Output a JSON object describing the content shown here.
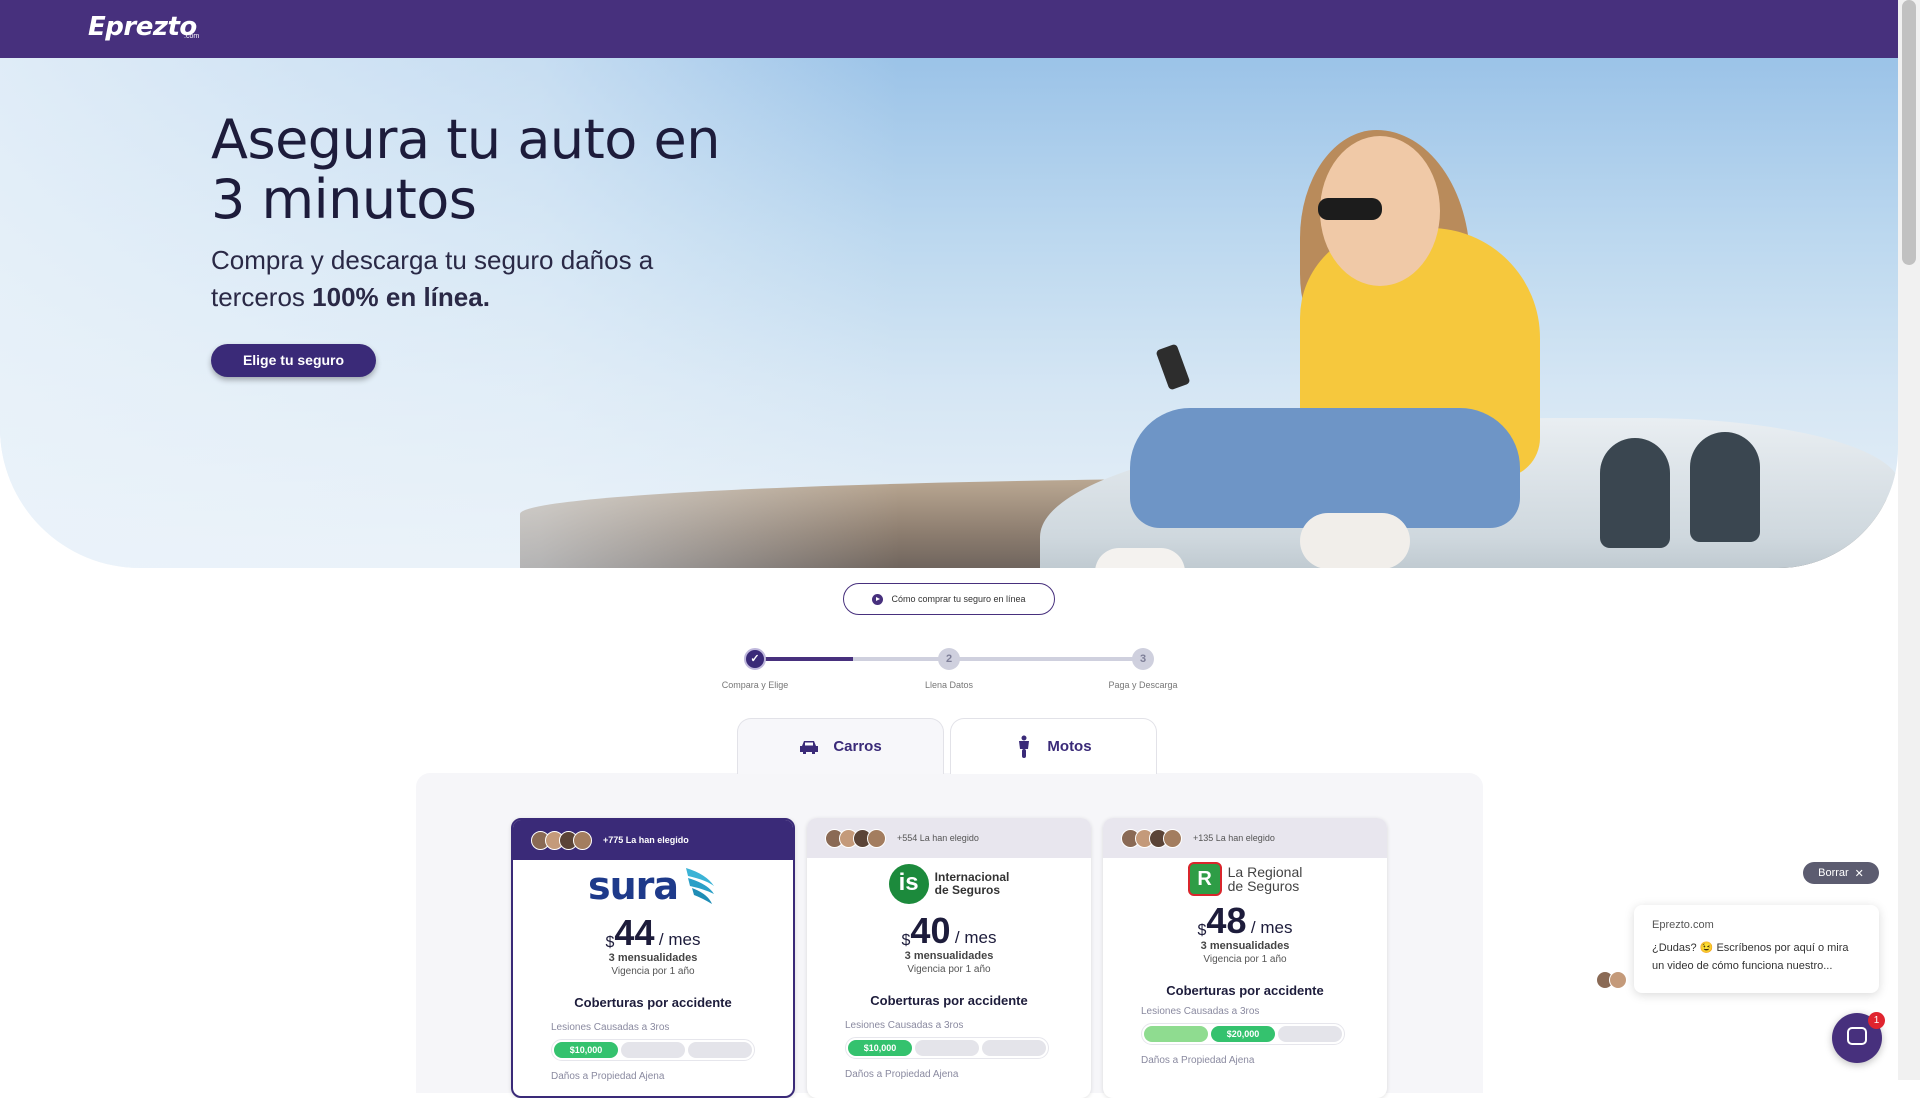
{
  "header": {
    "logo": "Eprezto",
    "logo_suffix": ".com"
  },
  "hero": {
    "title": "Asegura tu auto en 3 minutos",
    "subtitle_prefix": "Compra y descarga tu seguro daños a terceros ",
    "subtitle_bold": "100% en línea.",
    "cta": "Elige tu seguro"
  },
  "howto": {
    "label": "Cómo comprar tu seguro en línea",
    "icon": "play-icon"
  },
  "stepper": {
    "steps": [
      {
        "number": "✓",
        "label": "Compara y Elige",
        "state": "done"
      },
      {
        "number": "2",
        "label": "Llena Datos",
        "state": "todo"
      },
      {
        "number": "3",
        "label": "Paga y Descarga",
        "state": "todo"
      }
    ],
    "progress": 0.25
  },
  "tabs": [
    {
      "label": "Carros",
      "icon": "car-icon",
      "active": true
    },
    {
      "label": "Motos",
      "icon": "scooter-icon",
      "active": false
    }
  ],
  "cards": [
    {
      "chosen": "+775 La han elegido",
      "brand": "sura",
      "currency": "$",
      "price": "44",
      "per": "/ mes",
      "installments": "3 mensualidades",
      "validity": "Vigencia por 1 año",
      "coverage_title": "Coberturas por accidente",
      "cov1_label": "Lesiones Causadas a 3ros",
      "cov1_value": "$10,000",
      "cov2_label": "Daños a Propiedad Ajena"
    },
    {
      "chosen": "+554 La han elegido",
      "brand_line1": "Internacional",
      "brand_line2": "de Seguros",
      "brand_mark": "is",
      "currency": "$",
      "price": "40",
      "per": "/ mes",
      "installments": "3 mensualidades",
      "validity": "Vigencia por 1 año",
      "coverage_title": "Coberturas por accidente",
      "cov1_label": "Lesiones Causadas a 3ros",
      "cov1_value": "$10,000",
      "cov2_label": "Daños a Propiedad Ajena"
    },
    {
      "chosen": "+135 La han elegido",
      "brand_line1": "La Regional",
      "brand_line2": "de Seguros",
      "brand_mark": "R",
      "currency": "$",
      "price": "48",
      "per": "/ mes",
      "installments": "3 mensualidades",
      "validity": "Vigencia por 1 año",
      "coverage_title": "Coberturas por accidente",
      "cov1_label": "Lesiones Causadas a 3ros",
      "cov1_value": "$20,000",
      "cov2_label": "Daños a Propiedad Ajena"
    }
  ],
  "chat": {
    "dismiss": "Borrar",
    "from": "Eprezto.com",
    "message": "¿Dudas? 😉  Escríbenos por aquí o mira un video de cómo funciona nuestro...",
    "badge": "1"
  },
  "colors": {
    "brand": "#47307d",
    "accent_green": "#34c26e"
  }
}
